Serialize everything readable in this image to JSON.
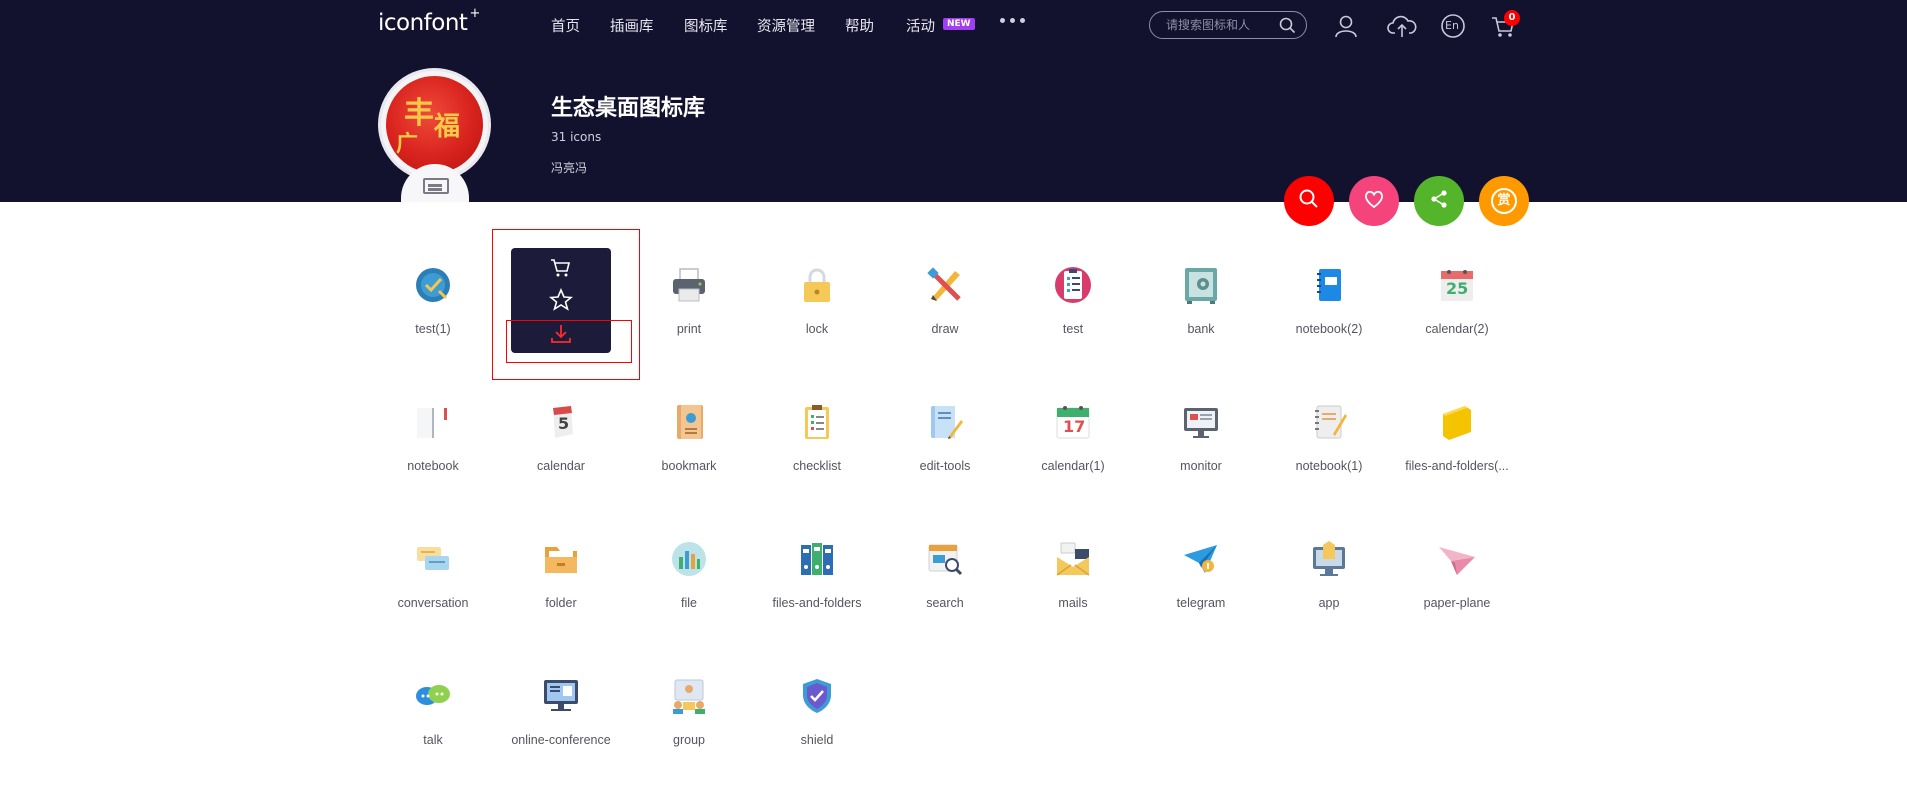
{
  "header": {
    "logo": "iconfont",
    "logo_mark": "+",
    "nav": [
      {
        "label": "首页"
      },
      {
        "label": "插画库"
      },
      {
        "label": "图标库"
      },
      {
        "label": "资源管理"
      },
      {
        "label": "帮助"
      },
      {
        "label": "活动",
        "badge": "NEW"
      }
    ],
    "more_icon": "more-dots-icon",
    "search_placeholder": "请搜索图标和人",
    "cart_count": "0",
    "icons": [
      "user-icon",
      "upload-cloud-icon",
      "language-en-icon",
      "cart-icon"
    ],
    "language": "En"
  },
  "library": {
    "title": "生态桌面图标库",
    "count": "31 icons",
    "author": "冯亮冯"
  },
  "actions": [
    {
      "name": "search-action",
      "color": "#ff0000"
    },
    {
      "name": "favorite-action",
      "color": "#f4447b"
    },
    {
      "name": "share-action",
      "color": "#54b52a"
    },
    {
      "name": "reward-action",
      "color": "#ff9900",
      "label": "赏"
    }
  ],
  "hover_card": {
    "actions": [
      "cart-icon",
      "star-icon",
      "download-icon"
    ]
  },
  "icons": [
    {
      "name": "test(1)"
    },
    {
      "name": ""
    },
    {
      "name": "print"
    },
    {
      "name": "lock"
    },
    {
      "name": "draw"
    },
    {
      "name": "test"
    },
    {
      "name": "bank"
    },
    {
      "name": "notebook(2)"
    },
    {
      "name": "calendar(2)"
    },
    {
      "name": "notebook"
    },
    {
      "name": "calendar"
    },
    {
      "name": "bookmark"
    },
    {
      "name": "checklist"
    },
    {
      "name": "edit-tools"
    },
    {
      "name": "calendar(1)"
    },
    {
      "name": "monitor"
    },
    {
      "name": "notebook(1)"
    },
    {
      "name": "files-and-folders(..."
    },
    {
      "name": "conversation"
    },
    {
      "name": "folder"
    },
    {
      "name": "file"
    },
    {
      "name": "files-and-folders"
    },
    {
      "name": "search"
    },
    {
      "name": "mails"
    },
    {
      "name": "telegram"
    },
    {
      "name": "app"
    },
    {
      "name": "paper-plane"
    },
    {
      "name": "talk"
    },
    {
      "name": "online-conference"
    },
    {
      "name": "group"
    },
    {
      "name": "shield"
    }
  ],
  "calendar_days": {
    "calendar2": "25",
    "calendar": "5",
    "calendar1": "17"
  },
  "colors": {
    "header_bg": "#12122f",
    "accent_red": "#ff0000",
    "badge_purple": "#a23ef1"
  }
}
